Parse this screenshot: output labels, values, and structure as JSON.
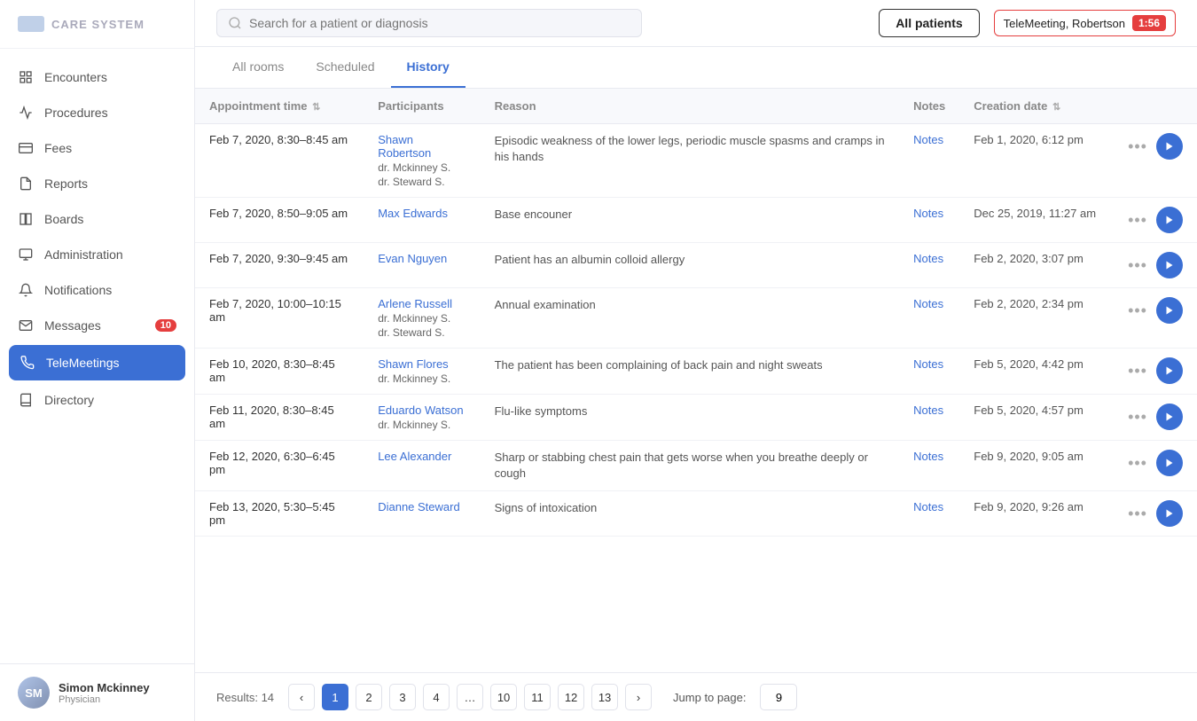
{
  "sidebar": {
    "logo_text": "CARE SYSTEM",
    "nav_items": [
      {
        "id": "encounters",
        "label": "Encounters",
        "icon": "grid-icon",
        "active": false
      },
      {
        "id": "procedures",
        "label": "Procedures",
        "icon": "activity-icon",
        "active": false
      },
      {
        "id": "fees",
        "label": "Fees",
        "icon": "creditcard-icon",
        "active": false
      },
      {
        "id": "reports",
        "label": "Reports",
        "icon": "file-icon",
        "active": false
      },
      {
        "id": "boards",
        "label": "Boards",
        "icon": "columns-icon",
        "active": false
      },
      {
        "id": "administration",
        "label": "Administration",
        "icon": "monitor-icon",
        "active": false
      },
      {
        "id": "notifications",
        "label": "Notifications",
        "icon": "bell-icon",
        "active": false
      },
      {
        "id": "messages",
        "label": "Messages",
        "icon": "mail-icon",
        "active": false,
        "badge": "10"
      },
      {
        "id": "telemeetings",
        "label": "TeleMeetings",
        "icon": "phone-icon",
        "active": true
      },
      {
        "id": "directory",
        "label": "Directory",
        "icon": "book-icon",
        "active": false
      }
    ],
    "user": {
      "name": "Simon Mckinney",
      "role": "Physician",
      "initials": "SM"
    }
  },
  "header": {
    "search_placeholder": "Search for a patient or diagnosis",
    "all_patients_label": "All patients",
    "telemeet_label": "TeleMeeting, Robertson",
    "telemeet_time": "1:56"
  },
  "tabs": [
    {
      "id": "all-rooms",
      "label": "All rooms",
      "active": false
    },
    {
      "id": "scheduled",
      "label": "Scheduled",
      "active": false
    },
    {
      "id": "history",
      "label": "History",
      "active": true
    }
  ],
  "table": {
    "columns": [
      {
        "id": "appointment_time",
        "label": "Appointment time",
        "sortable": true
      },
      {
        "id": "participants",
        "label": "Participants",
        "sortable": false
      },
      {
        "id": "reason",
        "label": "Reason",
        "sortable": false
      },
      {
        "id": "notes",
        "label": "Notes",
        "sortable": false
      },
      {
        "id": "creation_date",
        "label": "Creation date",
        "sortable": true
      }
    ],
    "rows": [
      {
        "appointment_time": "Feb 7, 2020, 8:30–8:45 am",
        "participant_name": "Shawn Robertson",
        "doctors": [
          "dr. Mckinney S.",
          "dr. Steward S."
        ],
        "reason": "Episodic weakness of the lower legs, periodic muscle spasms and cramps in his hands",
        "notes": "Notes",
        "creation_date": "Feb 1, 2020, 6:12 pm"
      },
      {
        "appointment_time": "Feb 7, 2020, 8:50–9:05 am",
        "participant_name": "Max Edwards",
        "doctors": [],
        "reason": "Base encouner",
        "notes": "Notes",
        "creation_date": "Dec 25, 2019, 11:27 am"
      },
      {
        "appointment_time": "Feb 7, 2020, 9:30–9:45 am",
        "participant_name": "Evan Nguyen",
        "doctors": [],
        "reason": "Patient has an albumin colloid allergy",
        "notes": "Notes",
        "creation_date": "Feb 2, 2020, 3:07 pm"
      },
      {
        "appointment_time": "Feb 7, 2020, 10:00–10:15 am",
        "participant_name": "Arlene Russell",
        "doctors": [
          "dr. Mckinney S.",
          "dr. Steward S."
        ],
        "reason": "Annual examination",
        "notes": "Notes",
        "creation_date": "Feb 2, 2020, 2:34 pm"
      },
      {
        "appointment_time": "Feb 10, 2020, 8:30–8:45 am",
        "participant_name": "Shawn Flores",
        "doctors": [
          "dr. Mckinney S."
        ],
        "reason": "The patient has been complaining of back pain and night sweats",
        "notes": "Notes",
        "creation_date": "Feb 5, 2020, 4:42 pm"
      },
      {
        "appointment_time": "Feb 11, 2020, 8:30–8:45 am",
        "participant_name": "Eduardo Watson",
        "doctors": [
          "dr. Mckinney S."
        ],
        "reason": "Flu-like symptoms",
        "notes": "Notes",
        "creation_date": "Feb 5, 2020, 4:57 pm"
      },
      {
        "appointment_time": "Feb 12, 2020, 6:30–6:45 pm",
        "participant_name": "Lee Alexander",
        "doctors": [],
        "reason": "Sharp or stabbing chest pain that gets worse when you breathe deeply or cough",
        "notes": "Notes",
        "creation_date": "Feb 9, 2020, 9:05 am"
      },
      {
        "appointment_time": "Feb 13, 2020, 5:30–5:45 pm",
        "participant_name": "Dianne Steward",
        "doctors": [],
        "reason": "Signs of intoxication",
        "notes": "Notes",
        "creation_date": "Feb 9, 2020, 9:26 am"
      }
    ]
  },
  "pagination": {
    "results_label": "Results: 14",
    "pages": [
      "1",
      "2",
      "3",
      "4",
      "...",
      "10",
      "11",
      "12",
      "13"
    ],
    "active_page": "1",
    "jump_label": "Jump to page:",
    "jump_value": "9",
    "prev_arrow": "‹",
    "next_arrow": "›"
  }
}
